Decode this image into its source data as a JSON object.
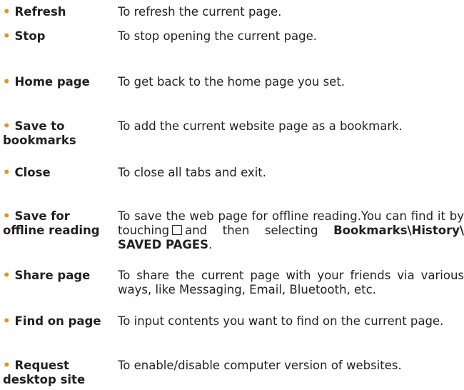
{
  "bullet": "•",
  "items": [
    {
      "term": "Refresh",
      "desc": "To refresh the current page."
    },
    {
      "term": "Stop",
      "desc": "To stop opening the current page."
    },
    {
      "term": "Home page",
      "desc": "To get back to the home page you set."
    },
    {
      "term": "Save to",
      "term2": "bookmarks",
      "desc": "To add the current website page as a bookmark."
    },
    {
      "term": "Close",
      "desc": "To close all tabs and exit."
    },
    {
      "term": "Save for",
      "term2": "offline reading",
      "desc_a": "To save the web page for offline reading.You can find it by touching",
      "icon": "tab-manager-box-icon",
      "desc_b": "and then selecting",
      "desc_bold": "Bookmarks\\History\\ SAVED PAGES",
      "desc_c": "."
    },
    {
      "term": "Share page",
      "desc": "To share the current page with your friends via various ways, like Messaging, Email, Bluetooth, etc."
    },
    {
      "term": "Find on page",
      "desc": "To input contents you want to find on the current page."
    },
    {
      "term": "Request",
      "term2": "desktop site",
      "desc": "To enable/disable computer version of websites."
    }
  ]
}
